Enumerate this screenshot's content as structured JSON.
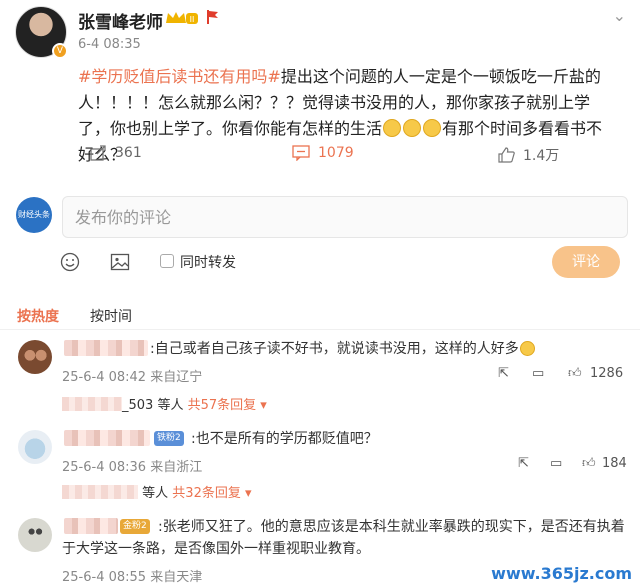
{
  "post": {
    "author": "张雪峰老师",
    "time": "6-4 08:35",
    "tag": "#学历贬值后读书还有用吗#",
    "text_part1": "提出这个问题的人一定是个一顿饭吃一斤盐的人！！！！怎么就那么闲？？？觉得读书没用的人，那你家孩子就别上学了，你也别上学了。你看你能有怎样的生活",
    "text_part2": "有那个时间多看看书不好么？",
    "reposts": "361",
    "comments": "1079",
    "likes": "1.4万",
    "crown_label": "II"
  },
  "input": {
    "placeholder": "发布你的评论",
    "avatar_label": "财经头条"
  },
  "tools": {
    "forward_label": "同时转发",
    "submit_label": "评论"
  },
  "tabs": {
    "hot": "按热度",
    "time": "按时间"
  },
  "comments": [
    {
      "text": ":自己或者自己孩子读不好书，就说读书没用，这样的人好多",
      "meta": "25-6-4 08:42 来自辽宁",
      "likes": "1286",
      "reply_suffix": "_503 等人",
      "reply_count": "共57条回复"
    },
    {
      "badge": "铁粉2",
      "text": ":也不是所有的学历都贬值吧？",
      "meta": "25-6-4 08:36 来自浙江",
      "likes": "184",
      "reply_suffix": "等人",
      "reply_count": "共32条回复"
    },
    {
      "badge": "金粉2",
      "text": ":张老师又狂了。他的意思应该是本科生就业率暴跌的现实下，是否还有执着于大学这一条路，是否像国外一样重视职业教育。",
      "meta": "25-6-4 08:55 来自天津"
    }
  ],
  "watermark": "www.365jz.com",
  "colors": {
    "accent": "#eb7350",
    "submit_bg": "#f8c38a",
    "link_blue": "#2a7ad0"
  }
}
